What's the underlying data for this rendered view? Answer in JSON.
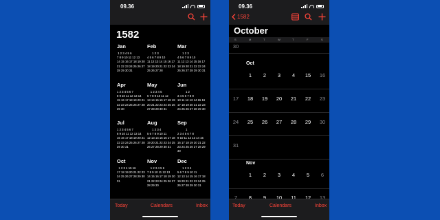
{
  "left": {
    "time": "09.36",
    "year": "1582",
    "months": [
      {
        "name": "Jan",
        "rows": [
          " 1 2 3 4 5 6",
          "7 8 9 10 11 12 13",
          "14 15 16 17 18 19 20",
          "21 22 23 24 25 26 27",
          "28 29 30 31"
        ]
      },
      {
        "name": "Feb",
        "rows": [
          "      1 2 3",
          "4 5 6 7 8 9 10",
          "11 12 13 14 15 16 17",
          "18 19 20 21 22 23 24",
          "25 26 27 28"
        ]
      },
      {
        "name": "Mar",
        "rows": [
          "      1 2 3",
          "4 5 6 7 8 9 10",
          "11 12 13 14 15 16 17",
          "18 19 20 21 22 23 24",
          "25 26 27 28 29 30 31"
        ]
      },
      {
        "name": "Apr",
        "rows": [
          "1 2 3 4 5 6 7",
          "8 9 10 11 12 13 14",
          "15 16 17 18 19 20 21",
          "22 23 24 25 26 27 28",
          "29 30"
        ]
      },
      {
        "name": "May",
        "rows": [
          "    1 2 3 4 5",
          "6 7 8 9 10 11 12",
          "13 14 15 16 17 18 19",
          "20 21 22 23 24 25 26",
          "27 28 29 30 31"
        ]
      },
      {
        "name": "Jun",
        "rows": [
          "          1 2",
          "3 4 5 6 7 8 9",
          "10 11 12 13 14 15 16",
          "17 18 19 20 21 22 23",
          "24 25 26 27 28 29 30"
        ]
      },
      {
        "name": "Jul",
        "rows": [
          "1 2 3 4 5 6 7",
          "8 9 10 11 12 13 14",
          "15 16 17 18 19 20 21",
          "22 23 24 25 26 27 28",
          "29 30 31"
        ]
      },
      {
        "name": "Aug",
        "rows": [
          "      1 2 3 4",
          "5 6 7 8 9 10 11",
          "12 13 14 15 16 17 18",
          "19 20 21 22 23 24 25",
          "26 27 28 29 30 31"
        ]
      },
      {
        "name": "Sep",
        "rows": [
          "          1",
          "2 3 4 5 6 7 8",
          "9 10 11 12 13 14 15",
          "16 17 18 19 20 21 22",
          "23 24 25 26 27 28 29",
          "30"
        ]
      },
      {
        "name": "Oct",
        "rows": [
          "  1 2 3 4 15 16",
          "17 18 19 20 21 22 23",
          "24 25 26 27 28 29 30",
          "31"
        ]
      },
      {
        "name": "Nov",
        "rows": [
          "    1 2 3 4 5 6",
          "7 8 9 10 11 12 13",
          "14 15 16 17 18 19 20",
          "21 22 23 24 25 26 27",
          "28 29 30"
        ]
      },
      {
        "name": "Dec",
        "rows": [
          "      1 2 3 4",
          "5 6 7 8 9 10 11",
          "12 13 14 15 16 17 18",
          "19 20 21 22 23 24 25",
          "26 27 28 29 30 31"
        ]
      }
    ],
    "tabs": {
      "today": "Today",
      "calendars": "Calendars",
      "inbox": "Inbox"
    }
  },
  "right": {
    "time": "09.36",
    "back_label": "1582",
    "month_title": "October",
    "weekdays": [
      "S",
      "M",
      "T",
      "W",
      "T",
      "F",
      "S"
    ],
    "prev_tail": "30",
    "oct_label": "Oct",
    "oct_rows": [
      [
        "1",
        "2",
        "3",
        "4",
        "15",
        "16"
      ],
      [
        "17",
        "18",
        "19",
        "20",
        "21",
        "22",
        "23"
      ],
      [
        "24",
        "25",
        "26",
        "27",
        "28",
        "29",
        "30"
      ],
      [
        "31"
      ]
    ],
    "nov_label": "Nov",
    "nov_rows": [
      [
        "1",
        "2",
        "3",
        "4",
        "5",
        "6"
      ],
      [
        "7",
        "8",
        "9",
        "10",
        "11",
        "12",
        "13"
      ]
    ],
    "tabs": {
      "today": "Today",
      "calendars": "Calendars",
      "inbox": "Inbox"
    }
  },
  "colors": {
    "accent": "#ff453a",
    "background": "#0c4fb3"
  }
}
